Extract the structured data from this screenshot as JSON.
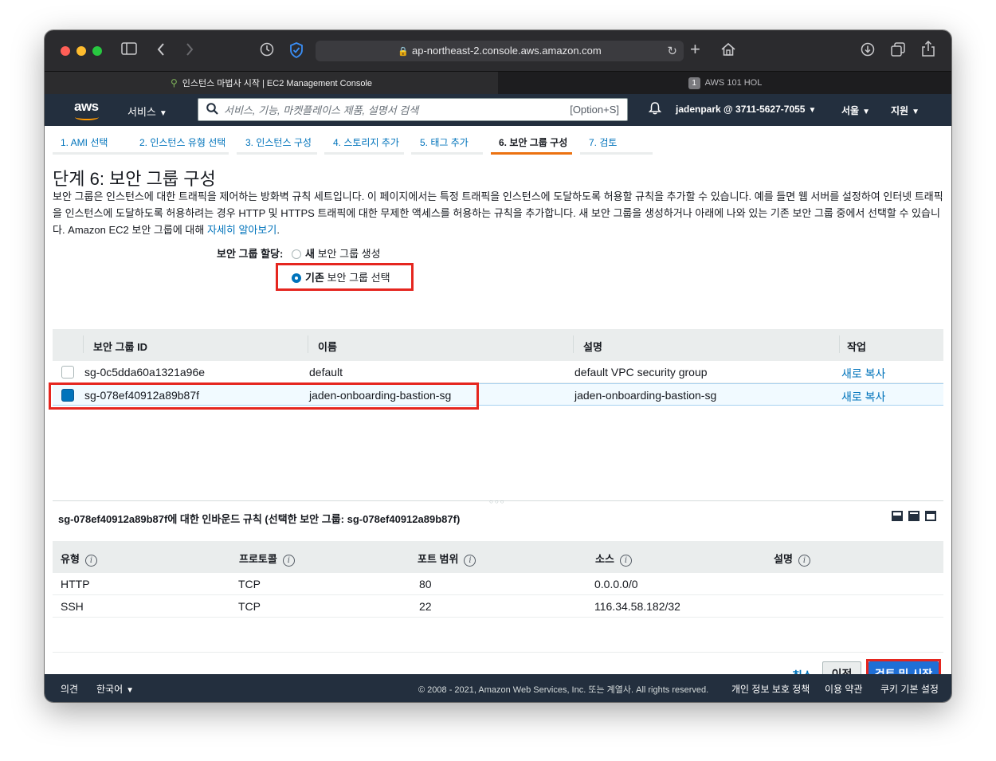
{
  "browser": {
    "url": "ap-northeast-2.console.aws.amazon.com",
    "tabs": [
      {
        "label": "인스턴스 마법사 시작 | EC2 Management Console",
        "active": true
      },
      {
        "label": "AWS 101 HOL",
        "badge": "1",
        "active": false
      }
    ]
  },
  "aws_nav": {
    "logo": "aws",
    "services": "서비스",
    "search_placeholder": "서비스, 기능, 마켓플레이스 제품, 설명서 검색",
    "search_shortcut": "[Option+S]",
    "account": "jadenpark @ 3711-5627-7055",
    "region": "서울",
    "support": "지원"
  },
  "steps": [
    {
      "label": "1. AMI 선택"
    },
    {
      "label": "2. 인스턴스 유형 선택"
    },
    {
      "label": "3. 인스턴스 구성"
    },
    {
      "label": "4. 스토리지 추가"
    },
    {
      "label": "5. 태그 추가"
    },
    {
      "label": "6. 보안 그룹 구성",
      "current": true
    },
    {
      "label": "7. 검토"
    }
  ],
  "page": {
    "title": "단계 6: 보안 그룹 구성",
    "description": "보안 그룹은 인스턴스에 대한 트래픽을 제어하는 방화벽 규칙 세트입니다. 이 페이지에서는 특정 트래픽을 인스턴스에 도달하도록 허용할 규칙을 추가할 수 있습니다. 예를 들면 웹 서버를 설정하여 인터넷 트래픽을 인스턴스에 도달하도록 허용하려는 경우 HTTP 및 HTTPS 트래픽에 대한 무제한 액세스를 허용하는 규칙을 추가합니다. 새 보안 그룹을 생성하거나 아래에 나와 있는 기존 보안 그룹 중에서 선택할 수 있습니다. Amazon EC2 보안 그룹에 대해",
    "learn_more": "자세히 알아보기",
    "period": ".",
    "assign_label": "보안 그룹 할당:",
    "radio_new_bold": "새",
    "radio_new_rest": "보안 그룹 생성",
    "radio_existing_bold": "기존",
    "radio_existing_rest": "보안 그룹 선택"
  },
  "sg_table": {
    "headers": [
      "보안 그룹 ID",
      "이름",
      "설명",
      "작업"
    ],
    "rows": [
      {
        "id": "sg-0c5dda60a1321a96e",
        "name": "default",
        "description": "default VPC security group",
        "action": "새로 복사",
        "selected": false
      },
      {
        "id": "sg-078ef40912a89b87f",
        "name": "jaden-onboarding-bastion-sg",
        "description": "jaden-onboarding-bastion-sg",
        "action": "새로 복사",
        "selected": true
      }
    ]
  },
  "inbound": {
    "title": "sg-078ef40912a89b87f에 대한 인바운드 규칙 (선택한 보안 그룹: sg-078ef40912a89b87f)",
    "headers": [
      "유형",
      "프로토콜",
      "포트 범위",
      "소스",
      "설명"
    ],
    "rows": [
      {
        "type": "HTTP",
        "protocol": "TCP",
        "port": "80",
        "source": "0.0.0.0/0",
        "description": ""
      },
      {
        "type": "SSH",
        "protocol": "TCP",
        "port": "22",
        "source": "116.34.58.182/32",
        "description": ""
      }
    ]
  },
  "actions": {
    "cancel": "취소",
    "previous": "이전",
    "review_launch": "검토 및 시작"
  },
  "footer": {
    "feedback": "의견",
    "language": "한국어",
    "copyright": "© 2008 - 2021, Amazon Web Services, Inc. 또는 계열사. All rights reserved.",
    "privacy": "개인 정보 보호 정책",
    "terms": "이용 약관",
    "cookies": "쿠키 기본 설정"
  },
  "colors": {
    "aws_nav_bg": "#232f3e",
    "link": "#0073bb",
    "highlight": "#e5261f",
    "primary_button": "#1f6fd6",
    "step_active_underline": "#ec7211"
  }
}
